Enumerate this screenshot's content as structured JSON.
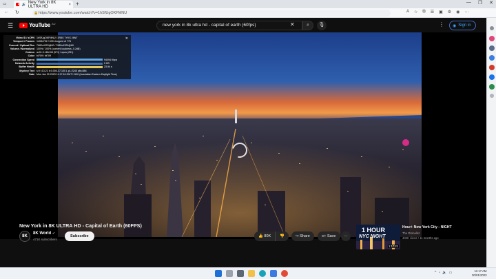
{
  "browser": {
    "tab_title": "New York in 8K ULTRA HD",
    "tab_close": "×",
    "new_tab": "+",
    "url": "https://www.youtube.com/watch?v=1hSfUgOKFMNU",
    "window_controls": [
      "—",
      "❐",
      "✕"
    ]
  },
  "youtube": {
    "logo_text": "YouTube",
    "logo_country": "AU",
    "search_value": "new york in 8k ultra hd - capital of earth (60fps)",
    "sign_in_label": "Sign in"
  },
  "stats": {
    "rows": [
      {
        "k": "Video ID / sCPN",
        "v": "1hSfUgOKFMNU  /  3R8S  7YKS  26NT"
      },
      {
        "k": "Viewport / Frames",
        "v": "1408x792 / 639 dropped of 776"
      },
      {
        "k": "Current / Optimal Res",
        "v": "7680x4320@60 / 7680x4320@60"
      },
      {
        "k": "Volume / Normalized",
        "v": "100% / 100% (content loudness -0.2dB)"
      },
      {
        "k": "Codecs",
        "v": "av01.0.16M.08 (571) / opus (251)"
      },
      {
        "k": "Color",
        "v": "bt709 / bt709"
      },
      {
        "k": "Connection Speed",
        "v": "94094 Kbps"
      },
      {
        "k": "Network Activity",
        "v": "0 KB"
      },
      {
        "k": "Buffer Health",
        "v": "23.94 s"
      },
      {
        "k": "Mystery Text",
        "v": "s:9 t:13.21 b:0.000-37.100 L pL:2240 pbs:884"
      },
      {
        "k": "Date",
        "v": "Mon Jan 30 2023 11:17:16 GMT+1100 (Australian Eastern Daylight Time)"
      }
    ],
    "close": "✕"
  },
  "video": {
    "title": "New York in 8K ULTRA HD - Capital of Earth (60FPS)",
    "channel_avatar": "8K",
    "channel_name": "8K World",
    "subscribers": "471K subscribers",
    "subscribe_label": "Subscribe",
    "likes": "80K",
    "share_label": "Share",
    "save_label": "Save"
  },
  "recommended": {
    "thumb_line1": "1 HOUR",
    "thumb_line2": "NYC NIGHT",
    "duration": "1:17:21",
    "title": "Hour+ New York City - NIGHT",
    "channel": "The Dronalist",
    "meta": "432K views  •  11 months ago"
  },
  "taskbar": {
    "tray_arrow": "^",
    "time": "11:17 AM",
    "date": "30/01/2023"
  },
  "colors": {
    "youtube_red": "#ff0000",
    "link_blue": "#3ea6ff",
    "dark_bg": "#0f0f0f"
  }
}
